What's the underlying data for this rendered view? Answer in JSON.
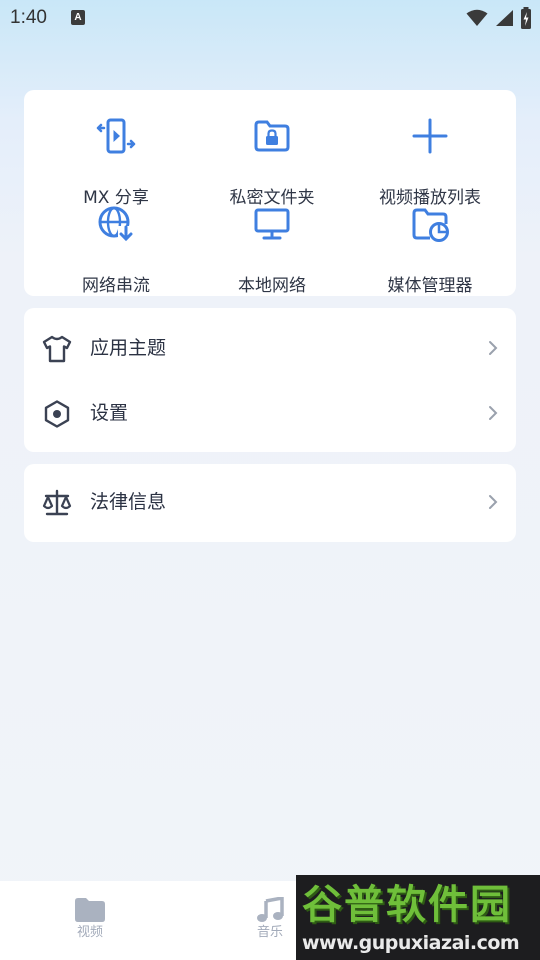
{
  "status_bar": {
    "time": "1:40",
    "notification_badge": "A",
    "icons": [
      "wifi-icon",
      "signal-icon",
      "battery-charging-icon"
    ]
  },
  "quick_actions": {
    "accent_color": "#3f7fe0",
    "items": [
      {
        "label": "MX 分享",
        "icon": "mx-share-icon"
      },
      {
        "label": "私密文件夹",
        "icon": "private-folder-icon"
      },
      {
        "label": "视频播放列表",
        "icon": "plus-icon"
      },
      {
        "label": "网络串流",
        "icon": "network-stream-icon"
      },
      {
        "label": "本地网络",
        "icon": "local-network-icon"
      },
      {
        "label": "媒体管理器",
        "icon": "media-manager-icon"
      }
    ]
  },
  "menu": {
    "items": [
      {
        "label": "应用主题",
        "icon": "theme-shirt-icon"
      },
      {
        "label": "设置",
        "icon": "settings-hex-icon"
      }
    ]
  },
  "legal": {
    "label": "法律信息",
    "icon": "scale-icon"
  },
  "bottom_nav": {
    "items": [
      {
        "label": "视频",
        "icon": "folder-icon"
      },
      {
        "label": "音乐",
        "icon": "music-note-icon"
      }
    ],
    "inactive_color": "#a3abba"
  },
  "watermark": {
    "logo_text": "谷普软件园",
    "url": "www.gupuxiazai.com"
  }
}
